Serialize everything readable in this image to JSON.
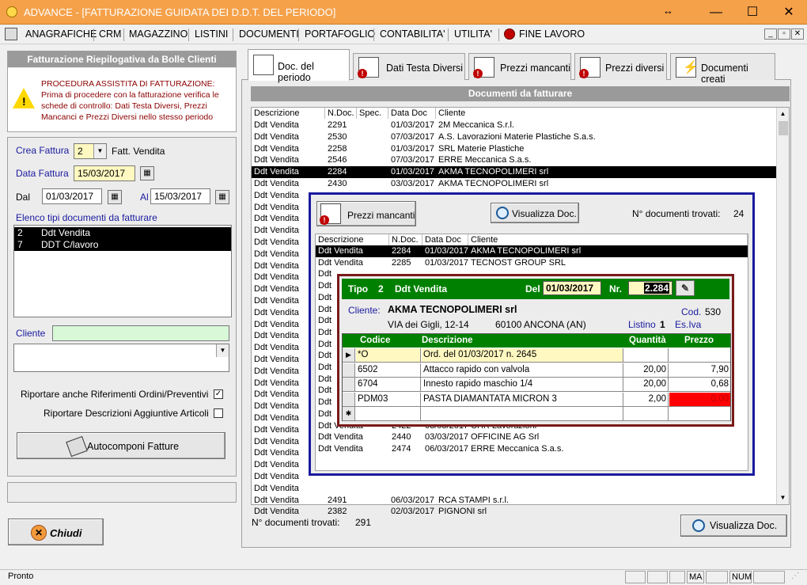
{
  "window": {
    "title": "ADVANCE - [FATTURAZIONE GUIDATA DEI D.D.T. DEL PERIODO]",
    "resize_glyph": "↔",
    "minimize": "—",
    "maximize": "☐",
    "close": "✕"
  },
  "menu": [
    "ANAGRAFICHE",
    "CRM",
    "MAGAZZINO",
    "LISTINI",
    "DOCUMENTI",
    "PORTAFOGLIO",
    "CONTABILITA'",
    "UTILITA'",
    "FINE LAVORO"
  ],
  "left": {
    "header": "Fatturazione Riepilogativa da Bolle Clienti",
    "notice": "PROCEDURA ASSISTITA DI FATTURAZIONE:\nPrima di procedere con la fatturazione verifica le schede di controllo: Dati Testa Diversi, Prezzi Mancanci e Prezzi Diversi nello stesso periodo",
    "crea_fattura_label": "Crea Fattura",
    "crea_fattura_value": "2",
    "crea_fattura_desc": "Fatt. Vendita",
    "data_fattura_label": "Data Fattura",
    "data_fattura_value": "15/03/2017",
    "dal_label": "Dal",
    "dal_value": "01/03/2017",
    "al_label": "Al",
    "al_value": "15/03/2017",
    "elenco_label": "Elenco tipi documenti da fatturare",
    "tipi": [
      {
        "code": "2",
        "desc": "Ddt Vendita"
      },
      {
        "code": "7",
        "desc": "DDT C/lavoro"
      }
    ],
    "cliente_label": "Cliente",
    "cliente_value": "",
    "check1_label": "Riportare anche Riferimenti Ordini/Preventivi",
    "check1": "✓",
    "check2_label": "Riportare Descrizioni Aggiuntive Articoli",
    "autocomponi_label": "Autocomponi Fatture",
    "chiudi_label": "Chiudi"
  },
  "tabs": [
    {
      "label": "Doc. del periodo",
      "active": true
    },
    {
      "label": "Dati Testa Diversi"
    },
    {
      "label": "Prezzi mancanti"
    },
    {
      "label": "Prezzi diversi"
    },
    {
      "label": "Documenti creati"
    }
  ],
  "main": {
    "header": "Documenti da fatturare",
    "columns": [
      "Descrizione",
      "N.Doc.",
      "Spec.",
      "Data Doc",
      "Cliente"
    ],
    "rows_top": [
      {
        "desc": "Ddt Vendita",
        "ndoc": "2291",
        "data": "01/03/2017",
        "cliente": "2M Meccanica S.r.l."
      },
      {
        "desc": "Ddt Vendita",
        "ndoc": "2530",
        "data": "07/03/2017",
        "cliente": "A.S. Lavorazioni Materie Plastiche S.a.s."
      },
      {
        "desc": "Ddt Vendita",
        "ndoc": "2258",
        "data": "01/03/2017",
        "cliente": "SRL Materie Plastiche"
      },
      {
        "desc": "Ddt Vendita",
        "ndoc": "2546",
        "data": "07/03/2017",
        "cliente": "ERRE Meccanica  S.a.s."
      },
      {
        "desc": "Ddt Vendita",
        "ndoc": "2284",
        "data": "01/03/2017",
        "cliente": "AKMA TECNOPOLIMERI srl",
        "selected": true
      },
      {
        "desc": "Ddt Vendita",
        "ndoc": "2430",
        "data": "03/03/2017",
        "cliente": "AKMA TECNOPOLIMERI srl"
      }
    ],
    "rows_bottom": [
      {
        "desc": "Ddt Vendita",
        "ndoc": "2491",
        "data": "06/03/2017",
        "cliente": "RCA STAMPI s.r.l."
      },
      {
        "desc": "Ddt Vendita",
        "ndoc": "2382",
        "data": "02/03/2017",
        "cliente": "PIGNONI srl"
      }
    ],
    "hidden_desc": "Ddt Vendita",
    "ndoc_label": "N° documenti trovati:",
    "ndoc_value": "291",
    "visualizza_label": "Visualizza Doc."
  },
  "overlay": {
    "prezzi_btn": "Prezzi mancanti",
    "visualizza_label": "Visualizza Doc.",
    "found_label": "N° documenti trovati:",
    "found_value": "24",
    "columns": [
      "Descrizione",
      "N.Doc.",
      "Data Doc",
      "Cliente"
    ],
    "rows_top": [
      {
        "desc": "Ddt Vendita",
        "ndoc": "2284",
        "data": "01/03/2017",
        "cliente": "AKMA TECNOPOLIMERI srl",
        "selected": true
      },
      {
        "desc": "Ddt Vendita",
        "ndoc": "2285",
        "data": "01/03/2017",
        "cliente": "TECNOST GROUP SRL"
      }
    ],
    "partial_desc": "Ddt",
    "rows_bottom": [
      {
        "desc": "Ddt Vendita",
        "ndoc": "2422",
        "data": "03/03/2017",
        "cliente": "CHR Lavorazioni"
      },
      {
        "desc": "Ddt Vendita",
        "ndoc": "2440",
        "data": "03/03/2017",
        "cliente": "OFFICINE AG Srl"
      },
      {
        "desc": "Ddt Vendita",
        "ndoc": "2474",
        "data": "06/03/2017",
        "cliente": "ERRE Meccanica  S.a.s."
      }
    ]
  },
  "detail": {
    "tipo_label": "Tipo",
    "tipo_value": "2",
    "tipo_desc": "Ddt Vendita",
    "del_label": "Del",
    "del_value": "01/03/2017",
    "nr_label": "Nr.",
    "nr_value": "2.284",
    "cliente_label": "Cliente:",
    "cliente_value": "AKMA TECNOPOLIMERI srl",
    "cod_label": "Cod.",
    "cod_value": "530",
    "indirizzo": "VIA dei Gigli, 12-14",
    "citta": "60100 ANCONA (AN)",
    "listino_label": "Listino",
    "listino_value": "1",
    "iva": "Es.Iva",
    "columns": [
      "Codice",
      "Descrizione",
      "Quantità",
      "Prezzo"
    ],
    "lines": [
      {
        "marker": "▶",
        "codice": "*O",
        "descrizione": "Ord. del 01/03/2017 n. 2645",
        "qta": "",
        "prezzo": ""
      },
      {
        "marker": "",
        "codice": "6502",
        "descrizione": "Attacco rapido con valvola",
        "qta": "20,00",
        "prezzo": "7,90"
      },
      {
        "marker": "",
        "codice": "6704",
        "descrizione": "Innesto rapido maschio 1/4",
        "qta": "20,00",
        "prezzo": "0,68"
      },
      {
        "marker": "",
        "codice": "PDM03",
        "descrizione": "PASTA DIAMANTATA MICRON 3",
        "qta": "2,00",
        "prezzo": "0,00"
      },
      {
        "marker": "✱",
        "codice": "",
        "descrizione": "",
        "qta": "",
        "prezzo": ""
      }
    ],
    "missing_price_color": "#ff0000"
  },
  "status": {
    "text": "Pronto",
    "ma": "MA",
    "num": "NUM"
  },
  "colors": {
    "titlebar": "#f5a14a",
    "green_header": "#008000",
    "blue_border": "#1a1aa0",
    "maroon_border": "#7a1a1a",
    "selection": "#000000"
  }
}
